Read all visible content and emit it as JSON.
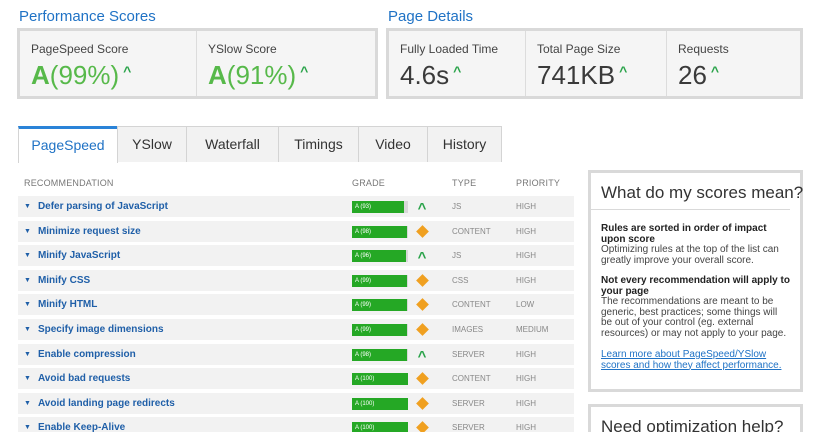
{
  "performance": {
    "title": "Performance Scores",
    "pagespeed": {
      "label": "PageSpeed Score",
      "grade": "A",
      "percent": "(99%)"
    },
    "yslow": {
      "label": "YSlow Score",
      "grade": "A",
      "percent": "(91%)"
    }
  },
  "details": {
    "title": "Page Details",
    "load_time": {
      "label": "Fully Loaded Time",
      "value": "4.6s"
    },
    "page_size": {
      "label": "Total Page Size",
      "value": "741KB"
    },
    "requests": {
      "label": "Requests",
      "value": "26"
    }
  },
  "tabs": [
    "PageSpeed",
    "YSlow",
    "Waterfall",
    "Timings",
    "Video",
    "History"
  ],
  "active_tab": "PageSpeed",
  "table": {
    "headers": {
      "recommendation": "RECOMMENDATION",
      "grade": "GRADE",
      "type": "TYPE",
      "priority": "PRIORITY"
    },
    "rows": [
      {
        "name": "Defer parsing of JavaScript",
        "grade": "A (93)",
        "score": 93,
        "trend": "up",
        "type": "JS",
        "priority": "HIGH"
      },
      {
        "name": "Minimize request size",
        "grade": "A (98)",
        "score": 98,
        "trend": "neutral",
        "type": "CONTENT",
        "priority": "HIGH"
      },
      {
        "name": "Minify JavaScript",
        "grade": "A (96)",
        "score": 96,
        "trend": "up",
        "type": "JS",
        "priority": "HIGH"
      },
      {
        "name": "Minify CSS",
        "grade": "A (99)",
        "score": 99,
        "trend": "neutral",
        "type": "CSS",
        "priority": "HIGH"
      },
      {
        "name": "Minify HTML",
        "grade": "A (99)",
        "score": 99,
        "trend": "neutral",
        "type": "CONTENT",
        "priority": "LOW"
      },
      {
        "name": "Specify image dimensions",
        "grade": "A (99)",
        "score": 99,
        "trend": "neutral",
        "type": "IMAGES",
        "priority": "MEDIUM"
      },
      {
        "name": "Enable compression",
        "grade": "A (98)",
        "score": 98,
        "trend": "up",
        "type": "SERVER",
        "priority": "HIGH"
      },
      {
        "name": "Avoid bad requests",
        "grade": "A (100)",
        "score": 100,
        "trend": "neutral",
        "type": "CONTENT",
        "priority": "HIGH"
      },
      {
        "name": "Avoid landing page redirects",
        "grade": "A (100)",
        "score": 100,
        "trend": "neutral",
        "type": "SERVER",
        "priority": "HIGH"
      },
      {
        "name": "Enable Keep-Alive",
        "grade": "A (100)",
        "score": 100,
        "trend": "neutral",
        "type": "SERVER",
        "priority": "HIGH"
      }
    ]
  },
  "sidebar": {
    "scores_title": "What do my scores mean?",
    "rules_heading": "Rules are sorted in order of impact upon score",
    "rules_text": "Optimizing rules at the top of the list can greatly improve your overall score.",
    "notevery_heading": "Not every recommendation will apply to your page",
    "notevery_text": "The recommendations are meant to be generic, best practices; some things will be out of your control (eg. external resources) or may not apply to your page.",
    "learn_link": "Learn more about PageSpeed/YSlow scores and how they affect performance.",
    "help_title": "Need optimization help?"
  },
  "colors": {
    "accent": "#1f72c5",
    "grade_green": "#25a825",
    "trend_up": "#2aa34a",
    "trend_neutral": "#f0a020"
  }
}
